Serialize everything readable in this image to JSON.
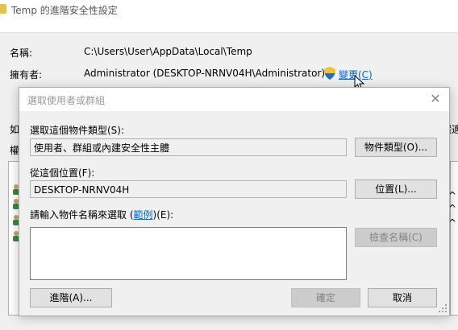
{
  "background_window": {
    "title": "Temp 的進階安全性設定",
    "name_label": "名稱:",
    "name_value": "C:\\Users\\User\\AppData\\Local\\Temp",
    "owner_label": "擁有者:",
    "owner_value": "Administrator (DESKTOP-NRNV04H\\Administrator)",
    "change_link": "變更(C)",
    "left_fragment_1": "如",
    "left_fragment_2": "權",
    "right_fragment_1": "選適",
    "right_fragment_2": "^",
    "right_fragment_3": "^",
    "right_fragment_4": "^"
  },
  "dialog": {
    "title": "選取使用者或群組",
    "object_type_label": "選取這個物件類型(S):",
    "object_type_value": "使用者、群組或內建安全性主體",
    "object_types_button": "物件類型(O)...",
    "location_label": "從這個位置(F):",
    "location_value": "DESKTOP-NRNV04H",
    "locations_button": "位置(L)...",
    "enter_names_prefix": "請輸入物件名稱來選取 (",
    "examples_link": "範例",
    "enter_names_suffix": ")(E):",
    "names_value": "",
    "check_names_button": "檢查名稱(C)",
    "advanced_button": "進階(A)...",
    "ok_button": "確定",
    "cancel_button": "取消"
  },
  "colors": {
    "link": "#0066cc",
    "dialog_bg": "#f0f0f0",
    "button_bg": "#e1e1e1",
    "disabled_button_bg": "#cccccc"
  }
}
